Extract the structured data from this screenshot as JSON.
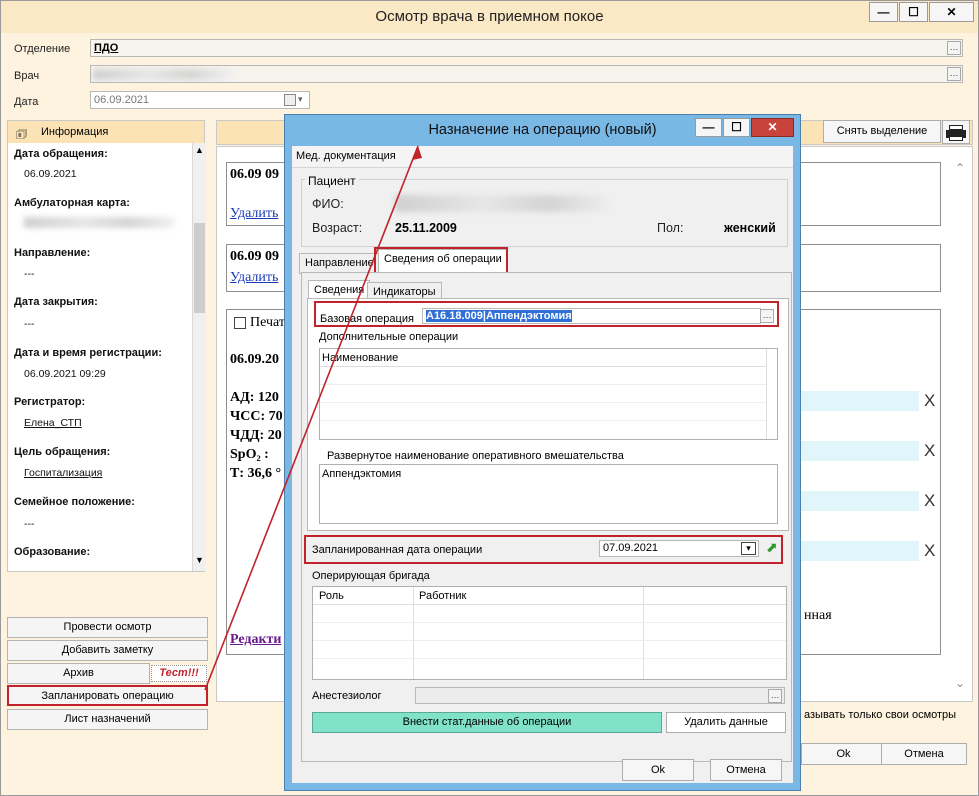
{
  "main_window": {
    "title": "Осмотр врача в приемном покое",
    "controls": {
      "minimize": "—",
      "maximize": "☐",
      "close": "✕"
    },
    "fields": {
      "department_label": "Отделение",
      "department_value": "ПДО",
      "doctor_label": "Врач",
      "date_label": "Дата",
      "date_value": "06.09.2021"
    },
    "sidebar": {
      "header": "Информация",
      "items": [
        {
          "label": "Дата обращения:",
          "value": "06.09.2021"
        },
        {
          "label": "Амбулаторная карта:",
          "value": ""
        },
        {
          "label": "Направление:",
          "value": "---"
        },
        {
          "label": "Дата закрытия:",
          "value": "---"
        },
        {
          "label": "Дата и время регистрации:",
          "value": "06.09.2021 09:29"
        },
        {
          "label": "Регистратор:",
          "value": "Елена_СТП"
        },
        {
          "label": "Цель обращения:",
          "value": "Госпитализация"
        },
        {
          "label": "Семейное положение:",
          "value": "---"
        },
        {
          "label": "Образование:",
          "value": ""
        }
      ]
    },
    "left_buttons": {
      "exam": "Провести осмотр",
      "note": "Добавить заметку",
      "archive": "Архив",
      "test_badge": "Тест!!!",
      "plan_operation": "Запланировать операцию",
      "prescriptions": "Лист назначений"
    },
    "toolbar": {
      "clear_selection": "Снять выделение"
    },
    "records": {
      "rec1_date": "06.09 09",
      "rec1_delete": "Удалить",
      "rec2_date": "06.09 09",
      "rec2_delete": "Удалить",
      "print_label": "Печат",
      "rec3_date": "06.09.20",
      "vitals": [
        "АД: 120",
        "ЧСС: 70",
        "ЧДД: 20",
        "SpO₂ :",
        "Т: 36,6 °"
      ],
      "edit_link": "Редакти",
      "right_partial": "нная",
      "close_x": "X"
    },
    "footer": {
      "own_only": "азывать только свои осмотры",
      "ok": "Ok",
      "cancel": "Отмена"
    }
  },
  "dialog": {
    "title": "Назначение на операцию (новый)",
    "controls": {
      "minimize": "—",
      "maximize": "☐",
      "close": "✕"
    },
    "menu": "Мед. документация",
    "patient": {
      "group": "Пациент",
      "fio_label": "ФИО:",
      "dob_label": "Возраст:",
      "dob_value": "25.11.2009",
      "sex_label": "Пол:",
      "sex_value": "женский"
    },
    "tabs": {
      "direction": "Направление",
      "operation_info": "Сведения об операции"
    },
    "subtabs": {
      "info": "Сведения",
      "indicators": "Индикаторы"
    },
    "base_operation_label": "Базовая операция",
    "base_operation_value": "A16.18.009|Аппендэктомия",
    "additional_ops_label": "Дополнительные операции",
    "additional_ops_header": "Наименование",
    "extended_name_label": "Развернутое наименование оперативного вмешательства",
    "extended_name_value": "Аппендэктомия",
    "planned_date_label": "Запланированная дата операции",
    "planned_date_value": "07.09.2021",
    "team_label": "Оперирующая бригада",
    "team_columns": [
      "Роль",
      "Работник"
    ],
    "anesthesiologist_label": "Анестезиолог",
    "stat_button": "Внести стат.данные об операции",
    "delete_data_button": "Удалить данные",
    "ok": "Ok",
    "cancel": "Отмена"
  },
  "colors": {
    "main_bg": "#fdf3df",
    "dialog_border": "#79b7e4",
    "highlight": "#c0232b",
    "close_red": "#c7433b",
    "stat_button": "#7fe2c9"
  }
}
